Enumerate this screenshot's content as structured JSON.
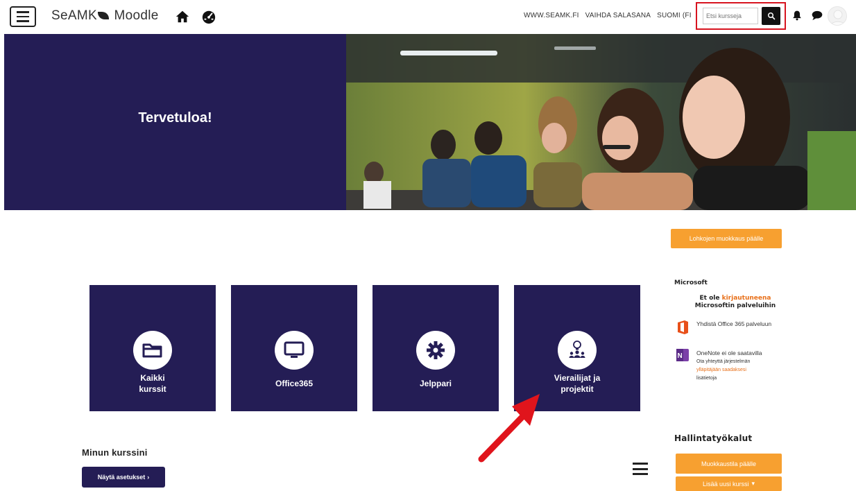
{
  "navbar": {
    "brand_left": "SeAMK",
    "brand_right": "Moodle",
    "links": [
      "WWW.SEAMK.FI",
      "VAIHDA SALASANA",
      "SUOMI (FI"
    ],
    "search_placeholder": "Etsi kursseja"
  },
  "hero": {
    "title": "Tervetuloa!"
  },
  "tiles": [
    {
      "label": "Kaikki\nkurssit",
      "icon": "folder-icon"
    },
    {
      "label": "Office365",
      "icon": "monitor-icon"
    },
    {
      "label": "Jelppari",
      "icon": "gear-icon"
    },
    {
      "label": "Vierailijat ja\nprojektit",
      "icon": "people-idea-icon"
    }
  ],
  "main": {
    "my_courses": "Minun kurssini",
    "show_settings": "Näytä asetukset"
  },
  "right": {
    "edit_blocks_button": "Lohkojen muokkaus päälle",
    "ms_heading": "Microsoft",
    "ms_notice_pre": "Et ole",
    "ms_notice_orange": "kirjautuneena",
    "ms_notice_post": "Microsoftin palveluihin",
    "ms_connect": "Yhdistä Office 365 palveluun",
    "onenote_title": "OneNote ei ole saatavilla",
    "onenote_line1": "Ota yhteyttä järjestelmän",
    "onenote_line2": "ylläpitäjään saadaksesi",
    "onenote_line3": "lisätietoja",
    "admin_heading": "Hallintatyökalut",
    "edit_on_button": "Muokkaustila päälle",
    "add_course_button": "Lisää uusi kurssi"
  },
  "colors": {
    "brand_navy": "#241d55",
    "accent_orange": "#f7a030",
    "highlight_red": "#d7131f"
  }
}
